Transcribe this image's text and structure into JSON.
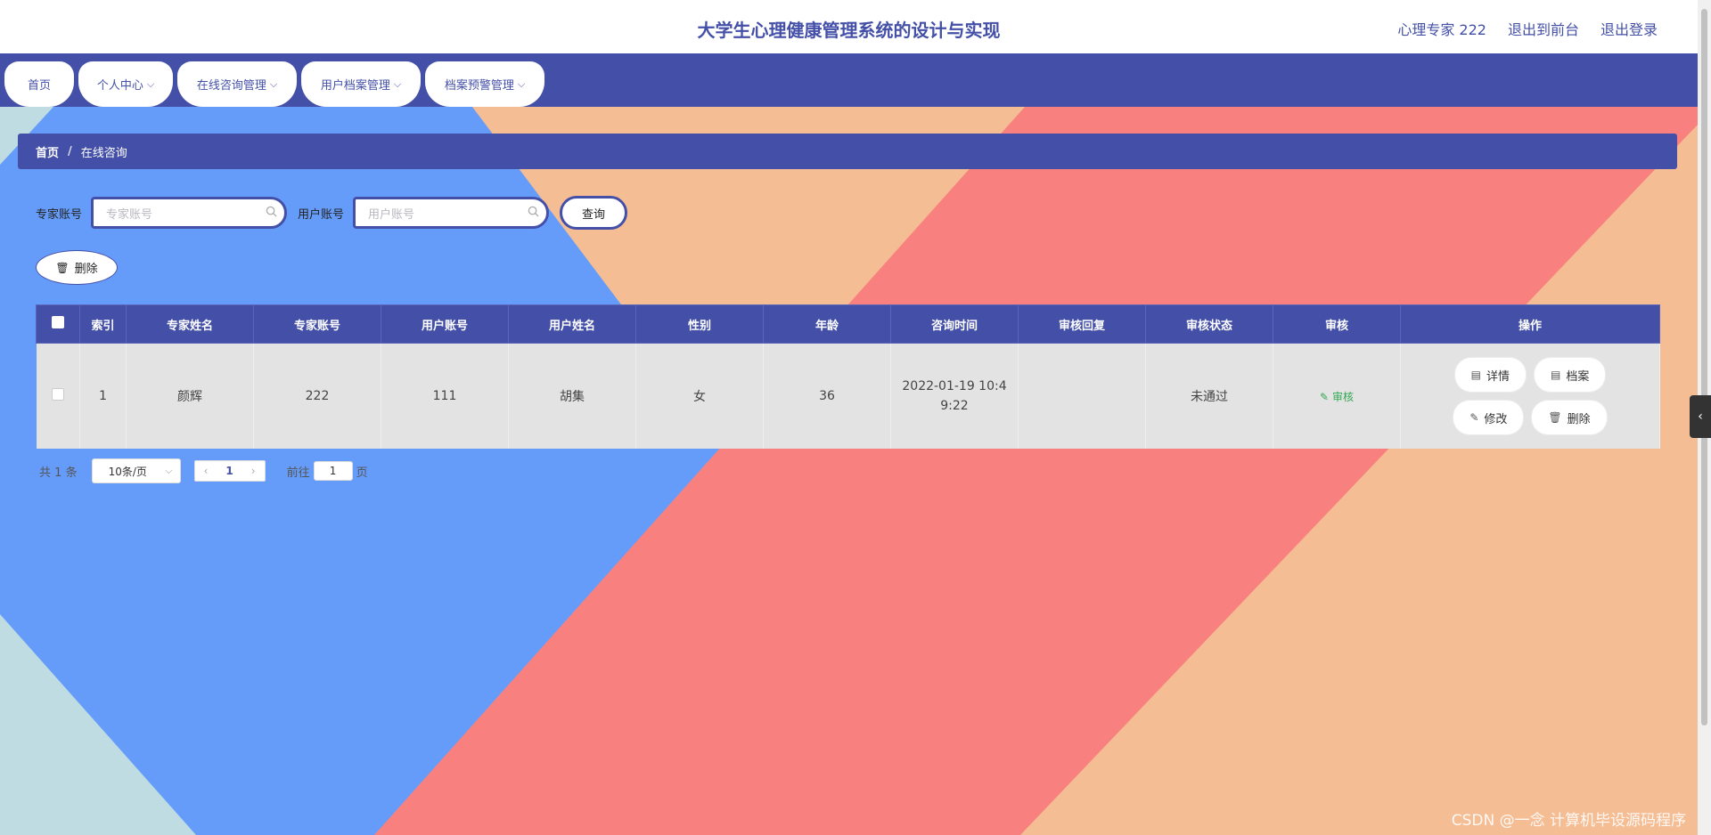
{
  "header": {
    "title": "大学生心理健康管理系统的设计与实现",
    "links": [
      "心理专家 222",
      "退出到前台",
      "退出登录"
    ]
  },
  "nav": {
    "tabs": [
      {
        "label": "首页",
        "has_dropdown": false
      },
      {
        "label": "个人中心",
        "has_dropdown": true
      },
      {
        "label": "在线咨询管理",
        "has_dropdown": true
      },
      {
        "label": "用户档案管理",
        "has_dropdown": true
      },
      {
        "label": "档案预警管理",
        "has_dropdown": true
      }
    ]
  },
  "breadcrumb": {
    "home": "首页",
    "separator": "/",
    "current": "在线咨询"
  },
  "search": {
    "expert_label": "专家账号",
    "expert_placeholder": "专家账号",
    "user_label": "用户账号",
    "user_placeholder": "用户账号",
    "query_label": "查询"
  },
  "batch_delete_label": "删除",
  "table": {
    "headers": [
      "索引",
      "专家姓名",
      "专家账号",
      "用户账号",
      "用户姓名",
      "性别",
      "年龄",
      "咨询时间",
      "审核回复",
      "审核状态",
      "审核",
      "操作"
    ],
    "rows": [
      {
        "index": "1",
        "expert_name": "颜辉",
        "expert_account": "222",
        "user_account": "111",
        "user_name": "胡集",
        "gender": "女",
        "age": "36",
        "consult_time": "2022-01-19 10:49:22",
        "audit_reply": "",
        "audit_status": "未通过",
        "audit_label": "审核",
        "actions": {
          "detail": "详情",
          "archive": "档案",
          "edit": "修改",
          "delete": "删除"
        }
      }
    ]
  },
  "pagination": {
    "total_prefix": "共",
    "total_value": "1",
    "total_suffix": "条",
    "page_size": "10条/页",
    "current_page": "1",
    "goto_prefix": "前往",
    "goto_value": "1",
    "goto_suffix": "页"
  },
  "watermark": "CSDN @一念 计算机毕设源码程序",
  "colors": {
    "primary": "#4450a8",
    "bg_blue": "#669cf9",
    "bg_salmon": "#f8817f",
    "bg_peach": "#f5bd93",
    "bg_lightblue": "#bfdce3",
    "audit_link": "#32a852"
  },
  "icons": [
    "search-icon",
    "trash-icon",
    "document-icon",
    "edit-icon",
    "chevron-down-icon",
    "chevron-left-icon",
    "chevron-right-icon"
  ]
}
